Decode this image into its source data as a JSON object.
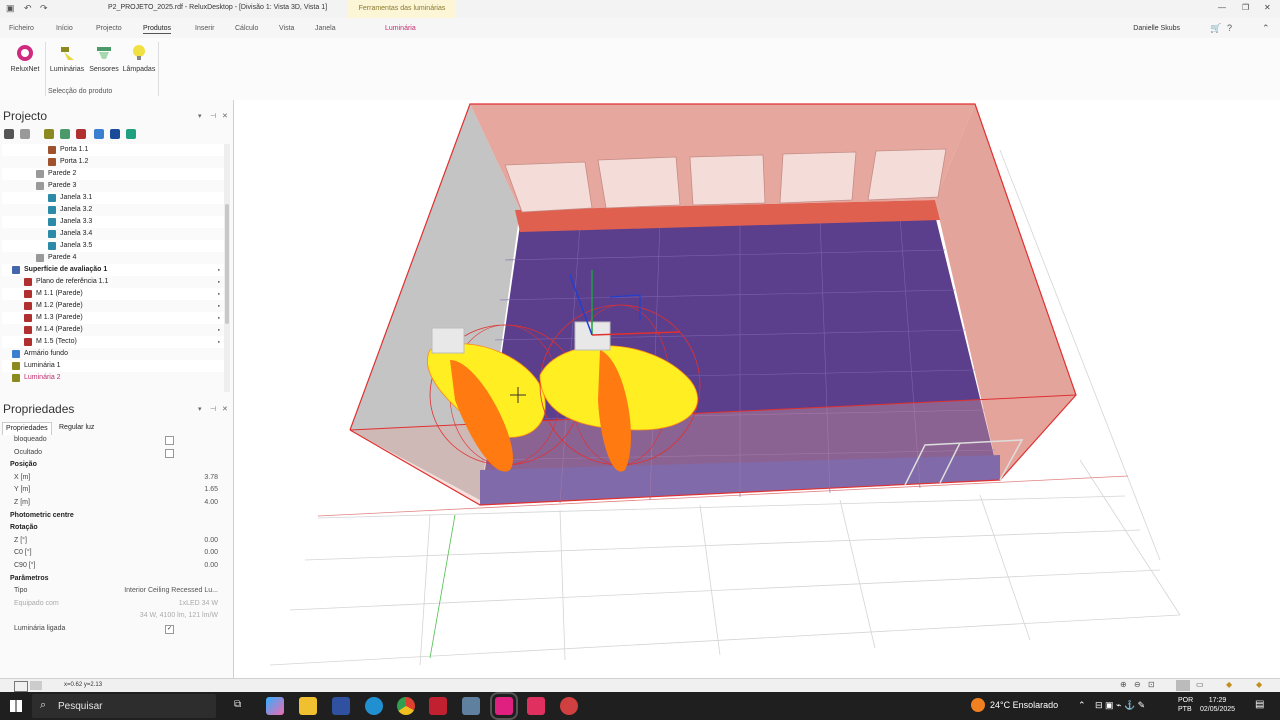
{
  "titlebar": {
    "title": "P2_PROJETO_2025.rdf - ReluxDesktop - [Divisão 1: Vista 3D, Vista 1]",
    "context_tab": "Ferramentas das luminárias"
  },
  "menu": {
    "items": [
      "Ficheiro",
      "Início",
      "Projecto",
      "Produtos",
      "Inserir",
      "Cálculo",
      "Vista",
      "Janela"
    ],
    "active": "Produtos",
    "context": "Luminária",
    "user": "Danielle Skubs"
  },
  "ribbon": {
    "buttons": [
      "ReluxNet",
      "Luminárias",
      "Sensores",
      "Lâmpadas"
    ],
    "group_label": "Selecção do produto"
  },
  "project_panel": {
    "title": "Projecto",
    "tree": [
      {
        "label": "Porta 1.1",
        "indent": 3,
        "icon": "door-icon",
        "color": "#a0522d"
      },
      {
        "label": "Porta 1.2",
        "indent": 3,
        "icon": "door-icon",
        "color": "#a0522d"
      },
      {
        "label": "Parede 2",
        "indent": 2,
        "icon": "wall-icon",
        "color": "#999999"
      },
      {
        "label": "Parede 3",
        "indent": 2,
        "icon": "wall-icon",
        "color": "#999999"
      },
      {
        "label": "Janela 3.1",
        "indent": 3,
        "icon": "window-icon",
        "color": "#2a8aa8"
      },
      {
        "label": "Janela 3.2",
        "indent": 3,
        "icon": "window-icon",
        "color": "#2a8aa8"
      },
      {
        "label": "Janela 3.3",
        "indent": 3,
        "icon": "window-icon",
        "color": "#2a8aa8"
      },
      {
        "label": "Janela 3.4",
        "indent": 3,
        "icon": "window-icon",
        "color": "#2a8aa8"
      },
      {
        "label": "Janela 3.5",
        "indent": 3,
        "icon": "window-icon",
        "color": "#2a8aa8"
      },
      {
        "label": "Parede 4",
        "indent": 2,
        "icon": "wall-icon",
        "color": "#999999"
      },
      {
        "label": "Superfície de avaliação 1",
        "indent": 0,
        "icon": "surface-icon",
        "color": "#4466aa",
        "bold": true,
        "lock": true
      },
      {
        "label": "Plano de referência 1.1",
        "indent": 1,
        "icon": "plane-icon",
        "color": "#b03030",
        "lock": true
      },
      {
        "label": "M 1.1 (Parede)",
        "indent": 1,
        "icon": "measure-icon",
        "color": "#b03030",
        "lock": true
      },
      {
        "label": "M 1.2 (Parede)",
        "indent": 1,
        "icon": "measure-icon",
        "color": "#b03030",
        "lock": true
      },
      {
        "label": "M 1.3 (Parede)",
        "indent": 1,
        "icon": "measure-icon",
        "color": "#b03030",
        "lock": true
      },
      {
        "label": "M 1.4 (Parede)",
        "indent": 1,
        "icon": "measure-icon",
        "color": "#b03030",
        "lock": true
      },
      {
        "label": "M 1.5 (Tecto)",
        "indent": 1,
        "icon": "measure-icon",
        "color": "#b03030",
        "lock": true
      },
      {
        "label": "Armário fundo",
        "indent": 0,
        "icon": "cabinet-icon",
        "color": "#3a7fd0"
      },
      {
        "label": "Luminária 1",
        "indent": 0,
        "icon": "luminaire-icon",
        "color": "#8a8a20"
      },
      {
        "label": "Luminária 2",
        "indent": 0,
        "icon": "luminaire-icon",
        "color": "#8a8a20",
        "selected": true
      }
    ]
  },
  "properties_panel": {
    "title": "Propriedades",
    "tabs": [
      "Propriedades",
      "Regular luz"
    ],
    "rows": [
      {
        "key": "bloqueado",
        "type": "check",
        "checked": false
      },
      {
        "key": "Ocultado",
        "type": "check",
        "checked": false
      },
      {
        "key": "Posição",
        "type": "section"
      },
      {
        "key": "X [m]",
        "value": "3.78"
      },
      {
        "key": "Y [m]",
        "value": "1.65"
      },
      {
        "key": "Z [m]",
        "value": "4.00"
      },
      {
        "key": "Photometric centre",
        "type": "section"
      },
      {
        "key": "Rotação",
        "type": "section"
      },
      {
        "key": "Z [°]",
        "value": "0.00"
      },
      {
        "key": "C0 [°]",
        "value": "0.00"
      },
      {
        "key": "C90 [°]",
        "value": "0.00"
      },
      {
        "key": "Parâmetros",
        "type": "section"
      },
      {
        "key": "Tipo",
        "value": "Interior Ceiling Recessed Lu..."
      },
      {
        "key": "Equipado com",
        "value": "1xLED 34 W",
        "faded": true
      },
      {
        "key": "",
        "value": "34 W, 4100 lm, 121 lm/W",
        "faded": true
      },
      {
        "key": "Luminária ligada",
        "type": "check",
        "checked": true
      }
    ]
  },
  "statusbar": {
    "coords": "x=0.62 y=2.13"
  },
  "taskbar": {
    "search": "Pesquisar",
    "weather": "24°C  Ensolarado",
    "lang": [
      "POR",
      "PTB"
    ],
    "time": "17:29",
    "date": "02/05/2025"
  },
  "colors": {
    "floor": "#5b3f8c",
    "wall": "#e8aaa4",
    "luminaire_light": "#ffee22",
    "luminaire_dark": "#ff7a10",
    "accent": "#c03070"
  }
}
